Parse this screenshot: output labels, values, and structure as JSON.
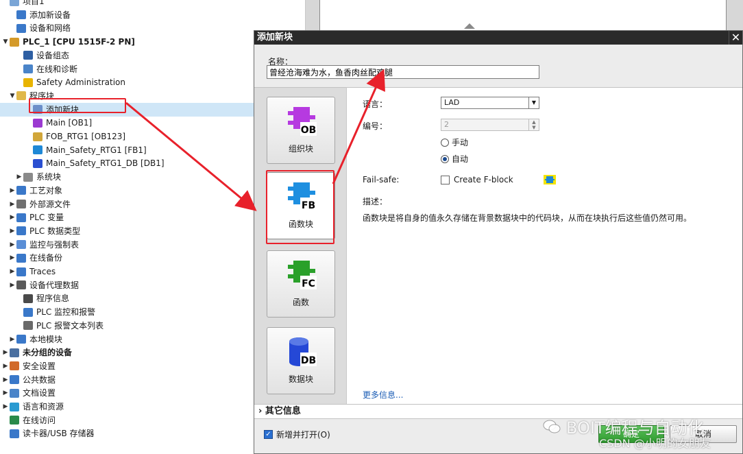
{
  "tree": {
    "rows": [
      {
        "label": "项目1",
        "indent": 0,
        "arrow": "",
        "icon": "project-icon",
        "color": "#7aa5d6"
      },
      {
        "label": "添加新设备",
        "indent": 1,
        "arrow": "",
        "icon": "add-device-icon",
        "color": "#3a78c9"
      },
      {
        "label": "设备和网络",
        "indent": 1,
        "arrow": "",
        "icon": "network-icon",
        "color": "#3a78c9"
      },
      {
        "label": "PLC_1 [CPU 1515F-2 PN]",
        "indent": 0,
        "arrow": "▼",
        "icon": "plc-icon",
        "color": "#d49a2a",
        "bold": true
      },
      {
        "label": "设备组态",
        "indent": 2,
        "arrow": "",
        "icon": "device-config-icon",
        "color": "#2e5fa3"
      },
      {
        "label": "在线和诊断",
        "indent": 2,
        "arrow": "",
        "icon": "diagnostics-icon",
        "color": "#4a84c9"
      },
      {
        "label": "Safety Administration",
        "indent": 2,
        "arrow": "",
        "icon": "safety-icon",
        "color": "#e8b400"
      },
      {
        "label": "程序块",
        "indent": 1,
        "arrow": "▼",
        "icon": "folder-icon",
        "color": "#e0b84a"
      },
      {
        "label": "添加新块",
        "indent": 3,
        "arrow": "",
        "icon": "add-block-icon",
        "color": "#6b8fc9",
        "selected": true
      },
      {
        "label": "Main [OB1]",
        "indent": 3,
        "arrow": "",
        "icon": "ob-icon",
        "color": "#9b3ad1"
      },
      {
        "label": "FOB_RTG1 [OB123]",
        "indent": 3,
        "arrow": "",
        "icon": "fob-icon",
        "color": "#d1a63a"
      },
      {
        "label": "Main_Safety_RTG1 [FB1]",
        "indent": 3,
        "arrow": "",
        "icon": "fb-icon",
        "color": "#1e88d6"
      },
      {
        "label": "Main_Safety_RTG1_DB [DB1]",
        "indent": 3,
        "arrow": "",
        "icon": "db-icon",
        "color": "#2a4fd1"
      },
      {
        "label": "系统块",
        "indent": 2,
        "arrow": "▶",
        "icon": "system-block-icon",
        "color": "#8a8a8a"
      },
      {
        "label": "工艺对象",
        "indent": 1,
        "arrow": "▶",
        "icon": "tech-object-icon",
        "color": "#3a78c9"
      },
      {
        "label": "外部源文件",
        "indent": 1,
        "arrow": "▶",
        "icon": "source-file-icon",
        "color": "#707070"
      },
      {
        "label": "PLC 变量",
        "indent": 1,
        "arrow": "▶",
        "icon": "plc-tag-icon",
        "color": "#3a78c9"
      },
      {
        "label": "PLC 数据类型",
        "indent": 1,
        "arrow": "▶",
        "icon": "data-type-icon",
        "color": "#3a78c9"
      },
      {
        "label": "监控与强制表",
        "indent": 1,
        "arrow": "▶",
        "icon": "watch-table-icon",
        "color": "#5a8ed6"
      },
      {
        "label": "在线备份",
        "indent": 1,
        "arrow": "▶",
        "icon": "backup-icon",
        "color": "#3a78c9"
      },
      {
        "label": "Traces",
        "indent": 1,
        "arrow": "▶",
        "icon": "trace-icon",
        "color": "#3a78c9"
      },
      {
        "label": "设备代理数据",
        "indent": 1,
        "arrow": "▶",
        "icon": "proxy-icon",
        "color": "#5a5a5a"
      },
      {
        "label": "程序信息",
        "indent": 2,
        "arrow": "",
        "icon": "program-info-icon",
        "color": "#4a4a4a"
      },
      {
        "label": "PLC 监控和报警",
        "indent": 2,
        "arrow": "",
        "icon": "alarm-icon",
        "color": "#3a78c9"
      },
      {
        "label": "PLC 报警文本列表",
        "indent": 2,
        "arrow": "",
        "icon": "text-list-icon",
        "color": "#6a6a6a"
      },
      {
        "label": "本地模块",
        "indent": 1,
        "arrow": "▶",
        "icon": "local-module-icon",
        "color": "#3a78c9"
      },
      {
        "label": "未分组的设备",
        "indent": 0,
        "arrow": "▶",
        "icon": "ungrouped-icon",
        "color": "#4a6fa0",
        "bold": true
      },
      {
        "label": "安全设置",
        "indent": 0,
        "arrow": "▶",
        "icon": "security-icon",
        "color": "#d16a2a"
      },
      {
        "label": "公共数据",
        "indent": 0,
        "arrow": "▶",
        "icon": "common-data-icon",
        "color": "#3a78c9"
      },
      {
        "label": "文档设置",
        "indent": 0,
        "arrow": "▶",
        "icon": "doc-settings-icon",
        "color": "#4a84c9"
      },
      {
        "label": "语言和资源",
        "indent": 0,
        "arrow": "▶",
        "icon": "language-icon",
        "color": "#2a9ad1"
      },
      {
        "label": "在线访问",
        "indent": 0,
        "arrow": "",
        "icon": "online-access-icon",
        "color": "#2a8a4a"
      },
      {
        "label": "读卡器/USB 存储器",
        "indent": 0,
        "arrow": "",
        "icon": "usb-icon",
        "color": "#3a78c9"
      }
    ]
  },
  "dialog": {
    "title": "添加新块",
    "close_glyph": "✕",
    "name_label": "名称：",
    "name_value": "曾经沧海难为水，鱼香肉丝配鸡腿",
    "block_types": [
      {
        "tag": "OB",
        "label": "组织块",
        "color": "#b63ae0"
      },
      {
        "tag": "FB",
        "label": "函数块",
        "color": "#1e8fe0",
        "active": true
      },
      {
        "tag": "FC",
        "label": "函数",
        "color": "#2aa02a"
      },
      {
        "tag": "DB",
        "label": "数据块",
        "color": "#2548d6"
      }
    ],
    "language_label": "语言：",
    "language_value": "LAD",
    "number_label": "编号：",
    "number_value": "2",
    "radio_manual": "手动",
    "radio_auto": "自动",
    "failsafe_label": "Fail-safe:",
    "failsafe_checkbox": "Create F-block",
    "description_label": "描述：",
    "description_text": "函数块是将自身的值永久存储在背景数据块中的代码块，从而在块执行后这些值仍然可用。",
    "more_info": "更多信息...",
    "other_info": "其它信息",
    "other_info_arrow": "›",
    "add_and_open": "新增并打开(O)",
    "ok": "确定",
    "cancel": "取消"
  },
  "watermark": {
    "main": "BOIT编程与自动化",
    "sub": "CSDN @小明的女朋友"
  },
  "colors": {
    "highlight": "#e8212b",
    "titlebar": "#2a2a2a",
    "selection": "#cfe6f7"
  }
}
